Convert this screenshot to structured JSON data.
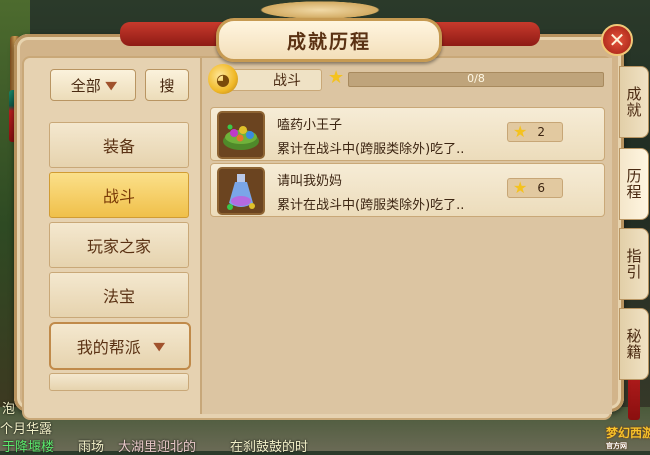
{
  "window": {
    "title": "成就历程",
    "close_symbol": "✕"
  },
  "filter": {
    "dropdown_value": "全部",
    "search_label": "搜"
  },
  "categories": [
    {
      "label": "装备",
      "active": false
    },
    {
      "label": "战斗",
      "active": true
    },
    {
      "label": "玩家之家",
      "active": false
    },
    {
      "label": "法宝",
      "active": false
    },
    {
      "label": "我的帮派",
      "active": false,
      "expandable": true
    }
  ],
  "progress": {
    "category_label": "战斗",
    "text": "0/8",
    "fraction": 0
  },
  "achievements": [
    {
      "title": "嗑药小王子",
      "desc": "累计在战斗中(跨服类除外)吃了..",
      "points": "2",
      "icon": "herb-bowl-icon"
    },
    {
      "title": "请叫我奶妈",
      "desc": "累计在战斗中(跨服类除外)吃了..",
      "points": "6",
      "icon": "potion-bottle-icon"
    }
  ],
  "side_tabs": [
    {
      "label": "成就",
      "active": false
    },
    {
      "label": "历程",
      "active": true
    },
    {
      "label": "指引",
      "active": false
    },
    {
      "label": "秘籍",
      "active": false
    }
  ],
  "background": {
    "chat_lines": [
      "个月华露",
      "于降堰楼",
      "雨场",
      "大湖里迎北的",
      "在刹鼓鼓的时"
    ],
    "side_text": "泡"
  },
  "logo": {
    "text": "梦幻西游",
    "sub": "官方网"
  },
  "colors": {
    "active_category": "#f0c04a",
    "star": "#f4c21f",
    "ribbon": "#c83a2c"
  }
}
